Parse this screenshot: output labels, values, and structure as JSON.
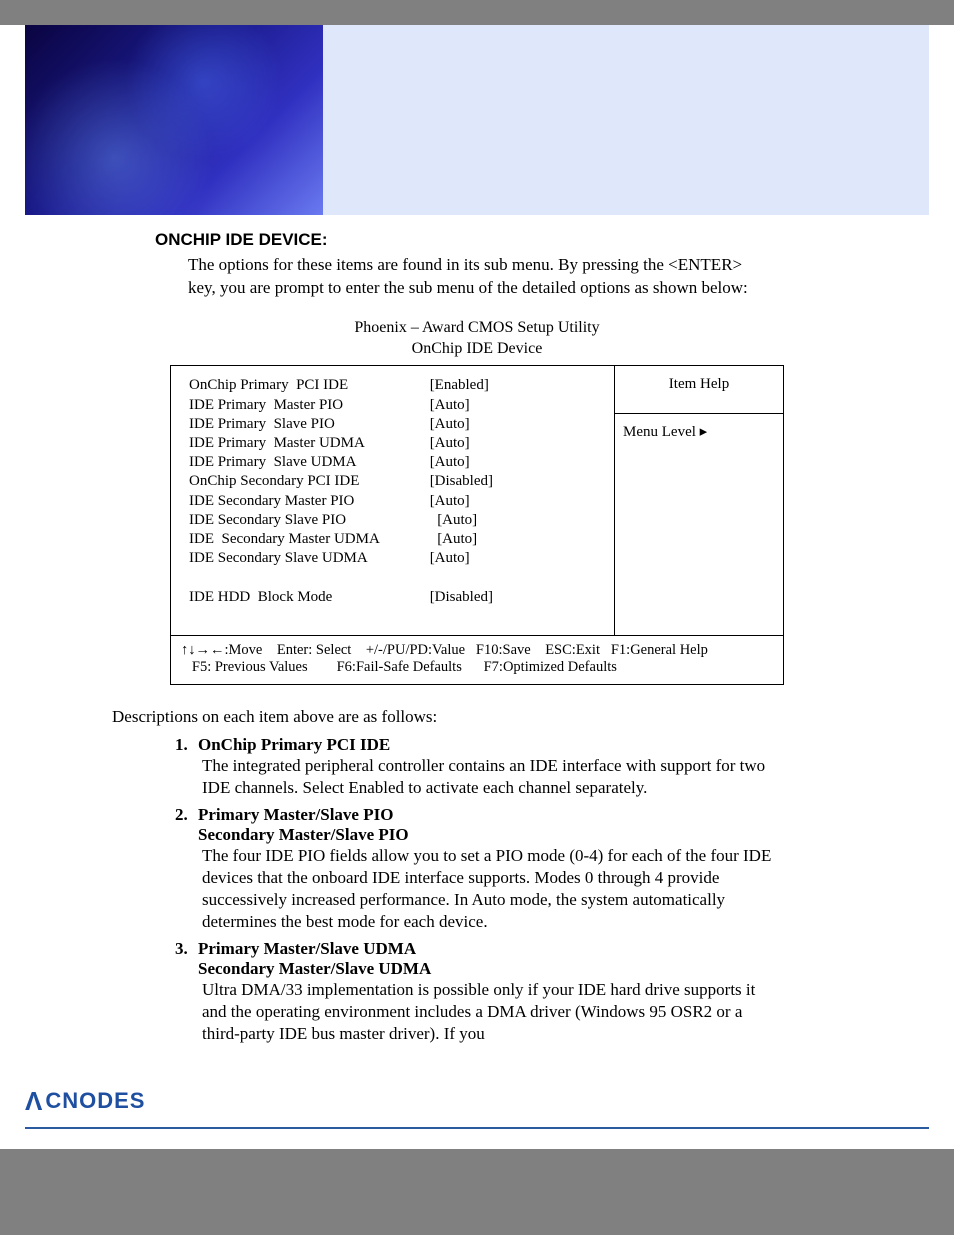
{
  "section_heading": "ONCHIP IDE DEVICE:",
  "intro_text": "The options for these items are found in its sub menu. By pressing the <ENTER> key, you are prompt to enter the sub menu of the detailed options as shown below:",
  "bios_title_line1": "Phoenix – Award CMOS Setup Utility",
  "bios_title_line2": "OnChip IDE Device",
  "bios_rows": [
    {
      "label": "OnChip Primary  PCI IDE",
      "value": "[Enabled]"
    },
    {
      "label": "IDE Primary  Master PIO",
      "value": "[Auto]"
    },
    {
      "label": "IDE Primary  Slave PIO",
      "value": "[Auto]"
    },
    {
      "label": "IDE Primary  Master UDMA",
      "value": "[Auto]"
    },
    {
      "label": "IDE Primary  Slave UDMA",
      "value": "[Auto]"
    },
    {
      "label": "OnChip Secondary PCI IDE",
      "value": "[Disabled]"
    },
    {
      "label": "IDE Secondary Master PIO",
      "value": "[Auto]"
    },
    {
      "label": "IDE Secondary Slave PIO",
      "value": "  [Auto]"
    },
    {
      "label": "IDE  Secondary Master UDMA",
      "value": "  [Auto]"
    },
    {
      "label": "IDE Secondary Slave UDMA",
      "value": "[Auto]"
    },
    {
      "label": "",
      "value": ""
    },
    {
      "label": "IDE HDD  Block Mode",
      "value": "[Disabled]"
    }
  ],
  "help_title": "Item Help",
  "menu_level_label": "Menu Level   ▸",
  "footer_line1": "↑↓→←:Move    Enter: Select    +/-/PU/PD:Value   F10:Save    ESC:Exit   F1:General Help",
  "footer_line2": "   F5: Previous Values        F6:Fail-Safe Defaults      F7:Optimized Defaults",
  "desc_intro": "Descriptions on each item above are as follows:",
  "items": [
    {
      "titles": [
        "OnChip Primary PCI IDE"
      ],
      "body": "The integrated peripheral controller contains an IDE interface with support for two IDE channels. Select Enabled to activate each channel separately."
    },
    {
      "titles": [
        "Primary Master/Slave PIO",
        "Secondary Master/Slave PIO"
      ],
      "body": "The four IDE PIO fields allow you to set a PIO mode (0-4) for each of the four IDE devices that the onboard IDE interface supports.   Modes 0 through 4 provide successively increased performance.   In Auto mode, the system automatically determines the best mode for each device."
    },
    {
      "titles": [
        "Primary Master/Slave UDMA",
        "Secondary Master/Slave UDMA"
      ],
      "body": "Ultra DMA/33 implementation is possible only if your IDE hard drive supports it and the operating environment includes a DMA driver (Windows 95 OSR2 or a third-party IDE bus master driver).   If you"
    }
  ],
  "logo_text": "CNODES"
}
